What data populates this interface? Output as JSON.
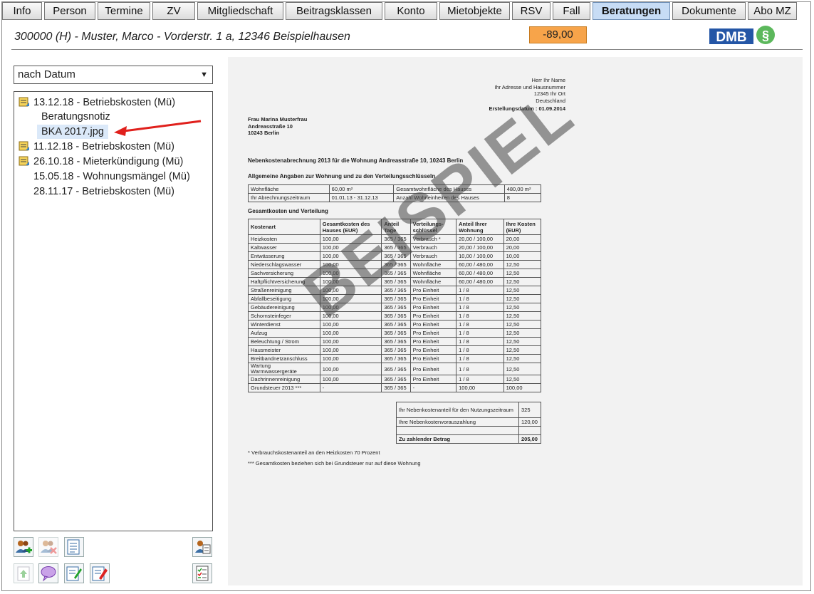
{
  "tabs": [
    {
      "label": "Info"
    },
    {
      "label": "Person"
    },
    {
      "label": "Termine"
    },
    {
      "label": "ZV"
    },
    {
      "label": "Mitgliedschaft"
    },
    {
      "label": "Beitragsklassen"
    },
    {
      "label": "Konto"
    },
    {
      "label": "Mietobjekte"
    },
    {
      "label": "RSV"
    },
    {
      "label": "Fall"
    },
    {
      "label": "Beratungen",
      "active": true
    },
    {
      "label": "Dokumente"
    },
    {
      "label": "Abo MZ"
    }
  ],
  "header": {
    "title": "300000 (H) - Muster, Marco - Vorderstr. 1 a, 12346 Beispielhausen",
    "balance": "-89,00",
    "logo_text": "DMB"
  },
  "sort": {
    "selected": "nach Datum"
  },
  "tree": {
    "items": [
      {
        "label": "13.12.18 - Betriebskosten (Mü)",
        "icon": "note-icon"
      },
      {
        "label": "Beratungsnotiz"
      },
      {
        "label": "BKA 2017.jpg",
        "selected": true
      },
      {
        "label": "11.12.18 - Betriebskosten (Mü)",
        "icon": "note-icon"
      },
      {
        "label": "26.10.18 - Mieterkündigung (Mü)",
        "icon": "note-icon"
      },
      {
        "label": "15.05.18 - Wohnungsmängel (Mü)"
      },
      {
        "label": "28.11.17 - Betriebskosten (Mü)"
      }
    ]
  },
  "tools": {
    "add_person": "add-person-icon",
    "remove_person": "remove-person-icon",
    "list": "list-icon",
    "person_edit": "person-edit-icon",
    "upload": "upload-icon",
    "comment": "comment-icon",
    "edit_doc": "edit-document-icon",
    "pin": "pin-icon",
    "checklist": "checklist-icon"
  },
  "document": {
    "sender": [
      "Herr Ihr Name",
      "Ihr Adresse und Hausnummer",
      "12345 Ihr Ort",
      "Deutschland"
    ],
    "date": "Erstellungsdatum : 01.09.2014",
    "recipient": [
      "Frau Marina Musterfrau",
      "Andreasstraße 10",
      "10243 Berlin"
    ],
    "subject": "Nebenkostenabrechnung 2013 für die Wohnung Andreasstraße 10, 10243 Berlin",
    "section1": "Allgemeine Angaben zur Wohnung und zu den Verteilungsschlüsseln",
    "general": {
      "row1": [
        "Wohnfläche",
        "60,00 m²",
        "Gesamtwohnfläche des Hauses",
        "480,00 m²"
      ],
      "row2": [
        "Ihr Abrechnungszeitraum",
        "01.01.13 - 31.12.13",
        "Anzahl Wohneinheiten des Hauses",
        "8"
      ]
    },
    "section2": "Gesamtkosten und Verteilung",
    "cost_headers": [
      "Kostenart",
      "Gesamtkosten des Hauses (EUR)",
      "Anteil Tage",
      "Verteilungs-schlüssel",
      "Anteil Ihrer Wohnung",
      "Ihre Kosten (EUR)"
    ],
    "cost_rows": [
      [
        "Heizkosten",
        "100,00",
        "365 / 365",
        "Verbrauch *",
        "20,00 / 100,00",
        "20,00"
      ],
      [
        "Kaltwasser",
        "100,00",
        "365 / 365",
        "Verbrauch",
        "20,00 / 100,00",
        "20,00"
      ],
      [
        "Entwässerung",
        "100,00",
        "365 / 365",
        "Verbrauch",
        "10,00 / 100,00",
        "10,00"
      ],
      [
        "Niederschlagswasser",
        "100,00",
        "365 / 365",
        "Wohnfläche",
        "60,00 / 480,00",
        "12,50"
      ],
      [
        "Sachversicherung",
        "100,00",
        "365 / 365",
        "Wohnfläche",
        "60,00 / 480,00",
        "12,50"
      ],
      [
        "Haftpflichtversicherung",
        "100,00",
        "365 / 365",
        "Wohnfläche",
        "60,00 / 480,00",
        "12,50"
      ],
      [
        "Straßenreinigung",
        "100,00",
        "365 / 365",
        "Pro Einheit",
        "1 / 8",
        "12,50"
      ],
      [
        "Abfallbeseitigung",
        "100,00",
        "365 / 365",
        "Pro Einheit",
        "1 / 8",
        "12,50"
      ],
      [
        "Gebäudereinigung",
        "100,00",
        "365 / 365",
        "Pro Einheit",
        "1 / 8",
        "12,50"
      ],
      [
        "Schornsteinfeger",
        "100,00",
        "365 / 365",
        "Pro Einheit",
        "1 / 8",
        "12,50"
      ],
      [
        "Winterdienst",
        "100,00",
        "365 / 365",
        "Pro Einheit",
        "1 / 8",
        "12,50"
      ],
      [
        "Aufzug",
        "100,00",
        "365 / 365",
        "Pro Einheit",
        "1 / 8",
        "12,50"
      ],
      [
        "Beleuchtung / Strom",
        "100,00",
        "365 / 365",
        "Pro Einheit",
        "1 / 8",
        "12,50"
      ],
      [
        "Hausmeister",
        "100,00",
        "365 / 365",
        "Pro Einheit",
        "1 / 8",
        "12,50"
      ],
      [
        "Breitbandnetzanschluss",
        "100,00",
        "365 / 365",
        "Pro Einheit",
        "1 / 8",
        "12,50"
      ],
      [
        "Wartung Warmwassergeräte",
        "100,00",
        "365 / 365",
        "Pro Einheit",
        "1 / 8",
        "12,50"
      ],
      [
        "Dachrinnenreinigung",
        "100,00",
        "365 / 365",
        "Pro Einheit",
        "1 / 8",
        "12,50"
      ],
      [
        "Grundsteuer 2013 ***",
        "-",
        "365 / 365",
        "-",
        "100,00",
        "100,00"
      ]
    ],
    "summary": [
      [
        "Ihr Nebenkostenanteil für den Nutzungszeitraum",
        "325"
      ],
      [
        "Ihre Nebenkostenvorauszahlung",
        "120,00"
      ],
      [
        "",
        ""
      ],
      [
        "Zu zahlender Betrag",
        "205,00"
      ]
    ],
    "note1": "* Verbrauchskostenanteil an den Heizkosten 70 Prozent",
    "note2": "*** Gesamtkosten beziehen sich bei Grundsteuer nur auf diese Wohnung",
    "watermark": "BEISPIEL"
  }
}
